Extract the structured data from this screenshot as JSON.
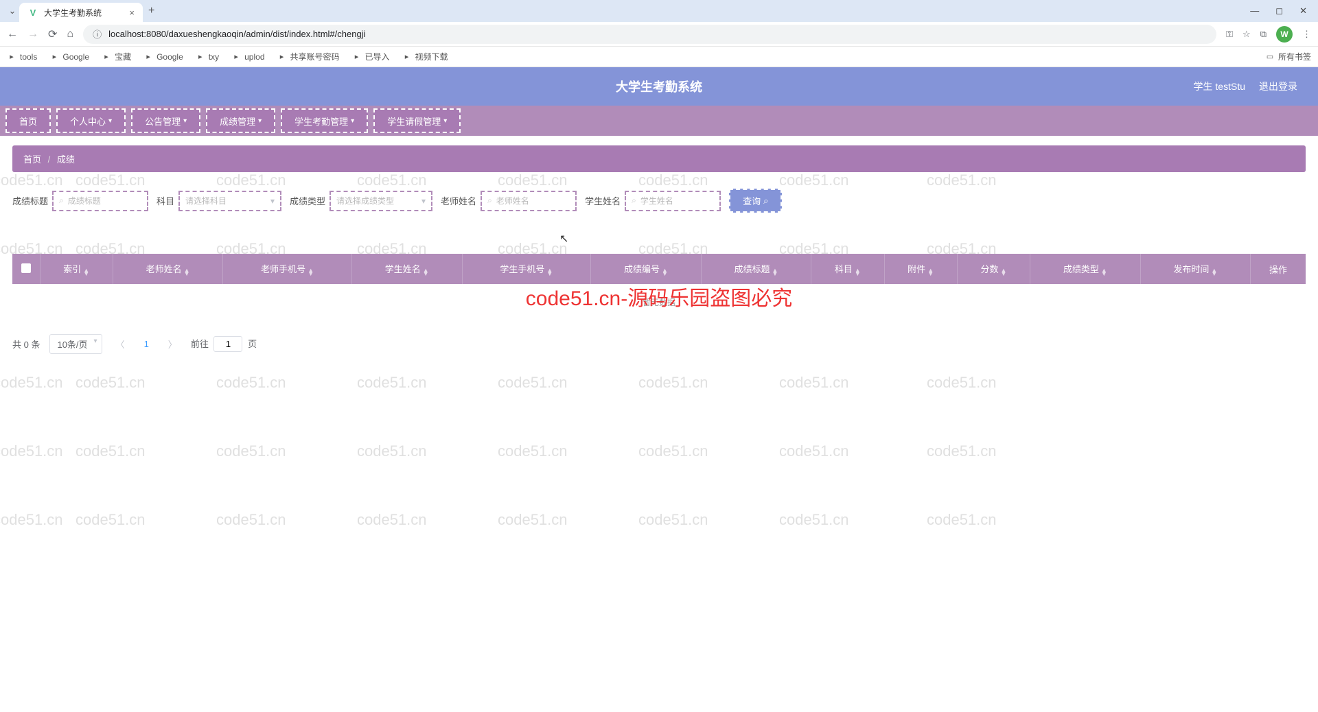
{
  "browser": {
    "tab_title": "大学生考勤系统",
    "url": "localhost:8080/daxueshengkaoqin/admin/dist/index.html#/chengji",
    "profile_letter": "W",
    "bookmarks": [
      "tools",
      "Google",
      "宝藏",
      "Google",
      "txy",
      "uplod",
      "共享账号密码",
      "已导入",
      "视频下载"
    ],
    "all_bookmarks": "所有书签"
  },
  "header": {
    "title": "大学生考勤系统",
    "user": "学生 testStu",
    "logout": "退出登录"
  },
  "nav": [
    {
      "label": "首页",
      "dropdown": false
    },
    {
      "label": "个人中心",
      "dropdown": true
    },
    {
      "label": "公告管理",
      "dropdown": true
    },
    {
      "label": "成绩管理",
      "dropdown": true
    },
    {
      "label": "学生考勤管理",
      "dropdown": true
    },
    {
      "label": "学生请假管理",
      "dropdown": true
    }
  ],
  "breadcrumb": {
    "home": "首页",
    "current": "成绩"
  },
  "search": {
    "title_label": "成绩标题",
    "title_ph": "成绩标题",
    "subject_label": "科目",
    "subject_ph": "请选择科目",
    "type_label": "成绩类型",
    "type_ph": "请选择成绩类型",
    "teacher_label": "老师姓名",
    "teacher_ph": "老师姓名",
    "student_label": "学生姓名",
    "student_ph": "学生姓名",
    "query_btn": "查询"
  },
  "table": {
    "columns": [
      "索引",
      "老师姓名",
      "老师手机号",
      "学生姓名",
      "学生手机号",
      "成绩编号",
      "成绩标题",
      "科目",
      "附件",
      "分数",
      "成绩类型",
      "发布时间",
      "操作"
    ],
    "empty": "暂无数据"
  },
  "pagination": {
    "total": "共 0 条",
    "per_page": "10条/页",
    "current": "1",
    "goto_prefix": "前往",
    "goto_value": "1",
    "goto_suffix": "页"
  },
  "watermark": {
    "grey": "code51.cn",
    "red": "code51.cn-源码乐园盗图必究"
  }
}
